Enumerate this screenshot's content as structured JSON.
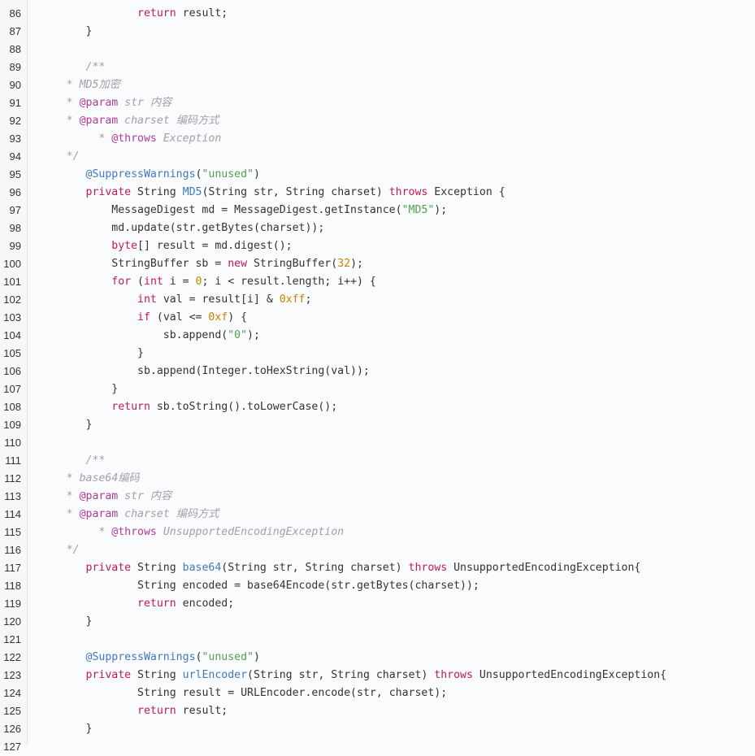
{
  "editor": {
    "colors": {
      "background": "#fafbfc",
      "gutter": "#f6f7f8",
      "keyword": "#c2185b",
      "comment": "#a0a1a7",
      "doc_tag": "#b03a9a",
      "function": "#4078c0",
      "string": "#50a14f",
      "number": "#c18401",
      "text": "#333333"
    },
    "lines": [
      {
        "n": "86",
        "indent": "                ",
        "tokens": [
          {
            "t": "kw",
            "v": "return"
          },
          {
            "t": "",
            "v": " result;"
          }
        ]
      },
      {
        "n": "87",
        "indent": "        ",
        "tokens": [
          {
            "t": "",
            "v": "}"
          }
        ]
      },
      {
        "n": "88",
        "indent": "",
        "tokens": []
      },
      {
        "n": "89",
        "indent": "        ",
        "tokens": [
          {
            "t": "cm",
            "v": "/**"
          }
        ]
      },
      {
        "n": "90",
        "indent": "     ",
        "tokens": [
          {
            "t": "cm",
            "v": "* MD5加密"
          }
        ]
      },
      {
        "n": "91",
        "indent": "     ",
        "tokens": [
          {
            "t": "cm",
            "v": "* "
          },
          {
            "t": "tag",
            "v": "@param"
          },
          {
            "t": "cm",
            "v": " str 内容"
          }
        ]
      },
      {
        "n": "92",
        "indent": "     ",
        "tokens": [
          {
            "t": "cm",
            "v": "* "
          },
          {
            "t": "tag",
            "v": "@param"
          },
          {
            "t": "cm",
            "v": " charset 编码方式"
          }
        ]
      },
      {
        "n": "93",
        "indent": "          ",
        "tokens": [
          {
            "t": "cm",
            "v": "* "
          },
          {
            "t": "tag",
            "v": "@throws"
          },
          {
            "t": "cm",
            "v": " Exception"
          }
        ]
      },
      {
        "n": "94",
        "indent": "     ",
        "tokens": [
          {
            "t": "cm",
            "v": "*/"
          }
        ]
      },
      {
        "n": "95",
        "indent": "        ",
        "tokens": [
          {
            "t": "ann",
            "v": "@SuppressWarnings"
          },
          {
            "t": "",
            "v": "("
          },
          {
            "t": "str",
            "v": "\"unused\""
          },
          {
            "t": "",
            "v": ")"
          }
        ]
      },
      {
        "n": "96",
        "indent": "        ",
        "tokens": [
          {
            "t": "kw",
            "v": "private"
          },
          {
            "t": "",
            "v": " String "
          },
          {
            "t": "fn",
            "v": "MD5"
          },
          {
            "t": "",
            "v": "(String str, String charset) "
          },
          {
            "t": "kw",
            "v": "throws"
          },
          {
            "t": "",
            "v": " Exception {"
          }
        ]
      },
      {
        "n": "97",
        "indent": "            ",
        "tokens": [
          {
            "t": "",
            "v": "MessageDigest md = MessageDigest.getInstance("
          },
          {
            "t": "str",
            "v": "\"MD5\""
          },
          {
            "t": "",
            "v": ");"
          }
        ]
      },
      {
        "n": "98",
        "indent": "            ",
        "tokens": [
          {
            "t": "",
            "v": "md.update(str.getBytes(charset));"
          }
        ]
      },
      {
        "n": "99",
        "indent": "            ",
        "tokens": [
          {
            "t": "kw",
            "v": "byte"
          },
          {
            "t": "",
            "v": "[] result = md.digest();"
          }
        ]
      },
      {
        "n": "100",
        "indent": "            ",
        "tokens": [
          {
            "t": "",
            "v": "StringBuffer sb = "
          },
          {
            "t": "kw",
            "v": "new"
          },
          {
            "t": "",
            "v": " StringBuffer("
          },
          {
            "t": "num",
            "v": "32"
          },
          {
            "t": "",
            "v": ");"
          }
        ]
      },
      {
        "n": "101",
        "indent": "            ",
        "tokens": [
          {
            "t": "kw",
            "v": "for"
          },
          {
            "t": "",
            "v": " ("
          },
          {
            "t": "kw",
            "v": "int"
          },
          {
            "t": "",
            "v": " i = "
          },
          {
            "t": "num",
            "v": "0"
          },
          {
            "t": "",
            "v": "; i < result.length; i++) {"
          }
        ]
      },
      {
        "n": "102",
        "indent": "                ",
        "tokens": [
          {
            "t": "kw",
            "v": "int"
          },
          {
            "t": "",
            "v": " val = result[i] & "
          },
          {
            "t": "num",
            "v": "0xff"
          },
          {
            "t": "",
            "v": ";"
          }
        ]
      },
      {
        "n": "103",
        "indent": "                ",
        "tokens": [
          {
            "t": "kw",
            "v": "if"
          },
          {
            "t": "",
            "v": " (val <= "
          },
          {
            "t": "num",
            "v": "0xf"
          },
          {
            "t": "",
            "v": ") {"
          }
        ]
      },
      {
        "n": "104",
        "indent": "                    ",
        "tokens": [
          {
            "t": "",
            "v": "sb.append("
          },
          {
            "t": "str",
            "v": "\"0\""
          },
          {
            "t": "",
            "v": ");"
          }
        ]
      },
      {
        "n": "105",
        "indent": "                ",
        "tokens": [
          {
            "t": "",
            "v": "}"
          }
        ]
      },
      {
        "n": "106",
        "indent": "                ",
        "tokens": [
          {
            "t": "",
            "v": "sb.append(Integer.toHexString(val));"
          }
        ]
      },
      {
        "n": "107",
        "indent": "            ",
        "tokens": [
          {
            "t": "",
            "v": "}"
          }
        ]
      },
      {
        "n": "108",
        "indent": "            ",
        "tokens": [
          {
            "t": "kw",
            "v": "return"
          },
          {
            "t": "",
            "v": " sb.toString().toLowerCase();"
          }
        ]
      },
      {
        "n": "109",
        "indent": "        ",
        "tokens": [
          {
            "t": "",
            "v": "}"
          }
        ]
      },
      {
        "n": "110",
        "indent": "",
        "tokens": []
      },
      {
        "n": "111",
        "indent": "        ",
        "tokens": [
          {
            "t": "cm",
            "v": "/**"
          }
        ]
      },
      {
        "n": "112",
        "indent": "     ",
        "tokens": [
          {
            "t": "cm",
            "v": "* base64编码"
          }
        ]
      },
      {
        "n": "113",
        "indent": "     ",
        "tokens": [
          {
            "t": "cm",
            "v": "* "
          },
          {
            "t": "tag",
            "v": "@param"
          },
          {
            "t": "cm",
            "v": " str 内容"
          }
        ]
      },
      {
        "n": "114",
        "indent": "     ",
        "tokens": [
          {
            "t": "cm",
            "v": "* "
          },
          {
            "t": "tag",
            "v": "@param"
          },
          {
            "t": "cm",
            "v": " charset 编码方式"
          }
        ]
      },
      {
        "n": "115",
        "indent": "          ",
        "tokens": [
          {
            "t": "cm",
            "v": "* "
          },
          {
            "t": "tag",
            "v": "@throws"
          },
          {
            "t": "cm",
            "v": " UnsupportedEncodingException"
          }
        ]
      },
      {
        "n": "116",
        "indent": "     ",
        "tokens": [
          {
            "t": "cm",
            "v": "*/"
          }
        ]
      },
      {
        "n": "117",
        "indent": "        ",
        "tokens": [
          {
            "t": "kw",
            "v": "private"
          },
          {
            "t": "",
            "v": " String "
          },
          {
            "t": "fn",
            "v": "base64"
          },
          {
            "t": "",
            "v": "(String str, String charset) "
          },
          {
            "t": "kw",
            "v": "throws"
          },
          {
            "t": "",
            "v": " UnsupportedEncodingException{"
          }
        ]
      },
      {
        "n": "118",
        "indent": "                ",
        "tokens": [
          {
            "t": "",
            "v": "String encoded = base64Encode(str.getBytes(charset));"
          }
        ]
      },
      {
        "n": "119",
        "indent": "                ",
        "tokens": [
          {
            "t": "kw",
            "v": "return"
          },
          {
            "t": "",
            "v": " encoded;"
          }
        ]
      },
      {
        "n": "120",
        "indent": "        ",
        "tokens": [
          {
            "t": "",
            "v": "}"
          }
        ]
      },
      {
        "n": "121",
        "indent": "",
        "tokens": []
      },
      {
        "n": "122",
        "indent": "        ",
        "tokens": [
          {
            "t": "ann",
            "v": "@SuppressWarnings"
          },
          {
            "t": "",
            "v": "("
          },
          {
            "t": "str",
            "v": "\"unused\""
          },
          {
            "t": "",
            "v": ")"
          }
        ]
      },
      {
        "n": "123",
        "indent": "        ",
        "tokens": [
          {
            "t": "kw",
            "v": "private"
          },
          {
            "t": "",
            "v": " String "
          },
          {
            "t": "fn",
            "v": "urlEncoder"
          },
          {
            "t": "",
            "v": "(String str, String charset) "
          },
          {
            "t": "kw",
            "v": "throws"
          },
          {
            "t": "",
            "v": " UnsupportedEncodingException{"
          }
        ]
      },
      {
        "n": "124",
        "indent": "                ",
        "tokens": [
          {
            "t": "",
            "v": "String result = URLEncoder.encode(str, charset);"
          }
        ]
      },
      {
        "n": "125",
        "indent": "                ",
        "tokens": [
          {
            "t": "kw",
            "v": "return"
          },
          {
            "t": "",
            "v": " result;"
          }
        ]
      },
      {
        "n": "126",
        "indent": "        ",
        "tokens": [
          {
            "t": "",
            "v": "}"
          }
        ]
      },
      {
        "n": "127",
        "indent": "",
        "tokens": []
      }
    ]
  }
}
